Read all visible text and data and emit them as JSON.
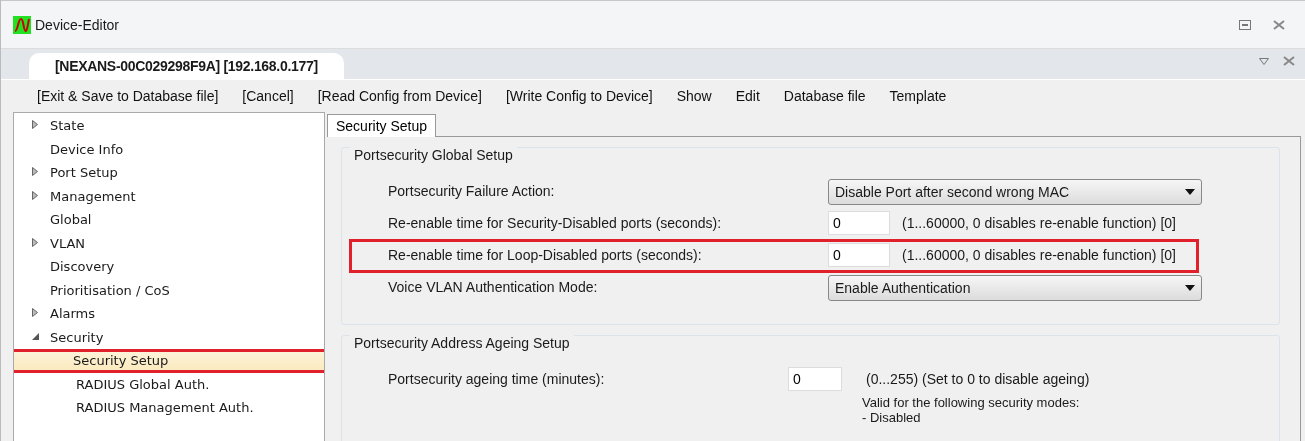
{
  "window": {
    "title": "Device-Editor"
  },
  "document_tab": {
    "label": "[NEXANS-00C029298F9A] [192.168.0.177]",
    "selected": true
  },
  "menu": [
    "[Exit & Save to Database file]",
    "[Cancel]",
    "[Read Config from Device]",
    "[Write Config to Device]",
    "Show",
    "Edit",
    "Database file",
    "Template"
  ],
  "tree": [
    {
      "label": "State",
      "expandable": true,
      "expanded": false,
      "selected": false,
      "highlighted": false
    },
    {
      "label": "Device Info",
      "expandable": false,
      "selected": false,
      "highlighted": false
    },
    {
      "label": "Port Setup",
      "expandable": true,
      "expanded": false,
      "selected": false,
      "highlighted": false
    },
    {
      "label": "Management",
      "expandable": true,
      "expanded": false,
      "selected": false,
      "highlighted": false
    },
    {
      "label": "Global",
      "expandable": false,
      "selected": false,
      "highlighted": false
    },
    {
      "label": "VLAN",
      "expandable": true,
      "expanded": false,
      "selected": false,
      "highlighted": false
    },
    {
      "label": "Discovery",
      "expandable": false,
      "selected": false,
      "highlighted": false
    },
    {
      "label": "Prioritisation / CoS",
      "expandable": false,
      "selected": false,
      "highlighted": false
    },
    {
      "label": "Alarms",
      "expandable": true,
      "expanded": false,
      "selected": false,
      "highlighted": false
    },
    {
      "label": "Security",
      "expandable": true,
      "expanded": true,
      "selected": false,
      "highlighted": false,
      "children": [
        {
          "label": "Security Setup",
          "expandable": false,
          "selected": true,
          "highlighted": true
        },
        {
          "label": "RADIUS Global Auth.",
          "expandable": false,
          "selected": false,
          "highlighted": false
        },
        {
          "label": "RADIUS Management Auth.",
          "expandable": false,
          "selected": false,
          "highlighted": false
        }
      ]
    }
  ],
  "content_tabs": [
    {
      "label": "Security Setup",
      "selected": true
    }
  ],
  "sections": [
    {
      "title": "Portsecurity Global Setup",
      "rows": [
        {
          "kind": "select",
          "label": "Portsecurity Failure Action:",
          "value": "Disable Port after second wrong MAC",
          "highlighted": false
        },
        {
          "kind": "number",
          "label": "Re-enable time for Security-Disabled ports (seconds):",
          "value": "0",
          "hint": "(1...60000, 0 disables re-enable function) [0]",
          "highlighted": false
        },
        {
          "kind": "number",
          "label": "Re-enable time for Loop-Disabled ports (seconds):",
          "value": "0",
          "hint": "(1...60000, 0 disables re-enable function) [0]",
          "highlighted": true
        },
        {
          "kind": "select",
          "label": "Voice VLAN Authentication Mode:",
          "value": "Enable Authentication",
          "highlighted": false
        }
      ]
    },
    {
      "title": "Portsecurity Address Ageing Setup",
      "rows": [
        {
          "kind": "number_note",
          "label": "Portsecurity ageing time (minutes):",
          "value": "0",
          "hint": "(0...255) (Set to 0 to disable ageing)",
          "notes": [
            "Valid for the following security modes:",
            "- Disabled"
          ],
          "highlighted": false
        }
      ]
    }
  ]
}
